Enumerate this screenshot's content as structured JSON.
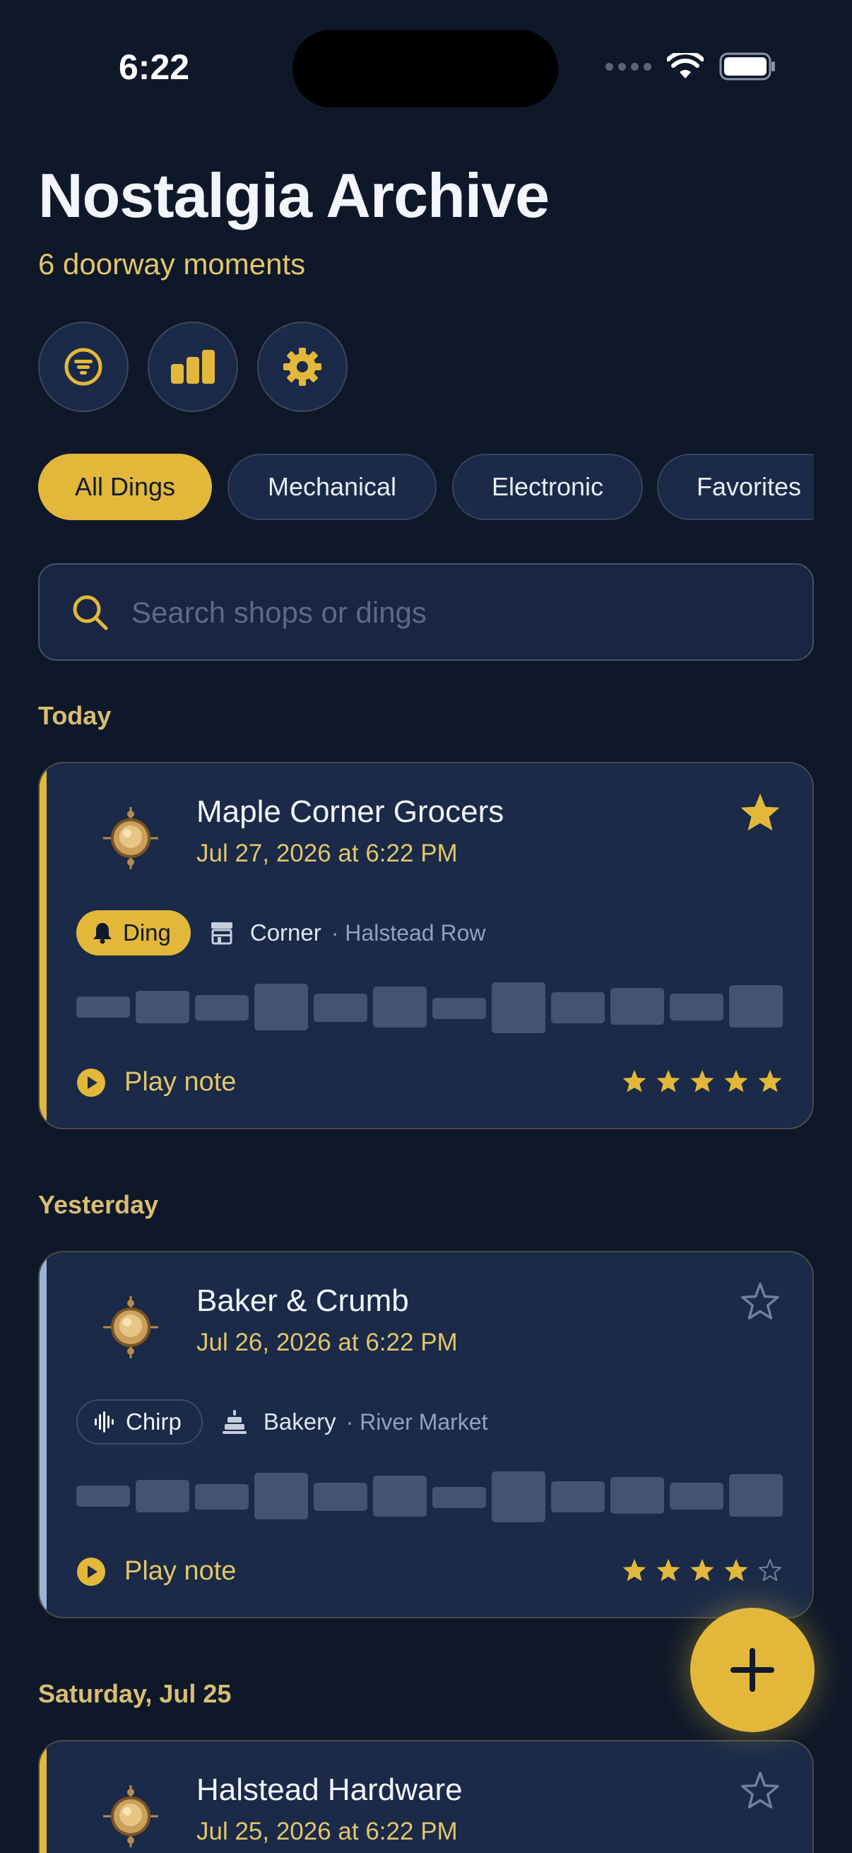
{
  "status_bar": {
    "time": "6:22"
  },
  "header": {
    "title": "Nostalgia Archive",
    "subtitle": "6 doorway moments"
  },
  "toolbar": {
    "icons": [
      "filter-icon",
      "stats-icon",
      "settings-icon"
    ]
  },
  "filters": {
    "chips": [
      {
        "label": "All Dings",
        "selected": true
      },
      {
        "label": "Mechanical",
        "selected": false
      },
      {
        "label": "Electronic",
        "selected": false
      },
      {
        "label": "Favorites",
        "selected": false
      }
    ]
  },
  "search": {
    "placeholder": "Search shops or dings",
    "value": ""
  },
  "sections": [
    {
      "label": "Today",
      "entries": [
        {
          "name": "Maple Corner Grocers",
          "date": "Jul 27, 2026 at 6:22 PM",
          "favorite": true,
          "kind": "Ding",
          "shop_type": "Corner",
          "place": "· Halstead Row",
          "play_label": "Play note",
          "rating": 5,
          "rating_max": 5,
          "accent_color": "#e3b83a"
        }
      ]
    },
    {
      "label": "Yesterday",
      "entries": [
        {
          "name": "Baker & Crumb",
          "date": "Jul 26, 2026 at 6:22 PM",
          "favorite": false,
          "kind": "Chirp",
          "shop_type": "Bakery",
          "place": "· River Market",
          "play_label": "Play note",
          "rating": 4,
          "rating_max": 5,
          "accent_color": "#9bb3d6"
        }
      ]
    },
    {
      "label": "Saturday, Jul 25",
      "entries": [
        {
          "name": "Halstead Hardware",
          "date": "Jul 25, 2026 at 6:22 PM",
          "favorite": false,
          "accent_color": "#e3b83a"
        }
      ]
    }
  ],
  "colors": {
    "background": "#0e1829",
    "card": "#1a2a48",
    "gold": "#e3b83a",
    "gold_text": "#e3c56a",
    "muted_blue": "#8ea2c7"
  },
  "fab": {
    "icon": "plus-icon"
  }
}
